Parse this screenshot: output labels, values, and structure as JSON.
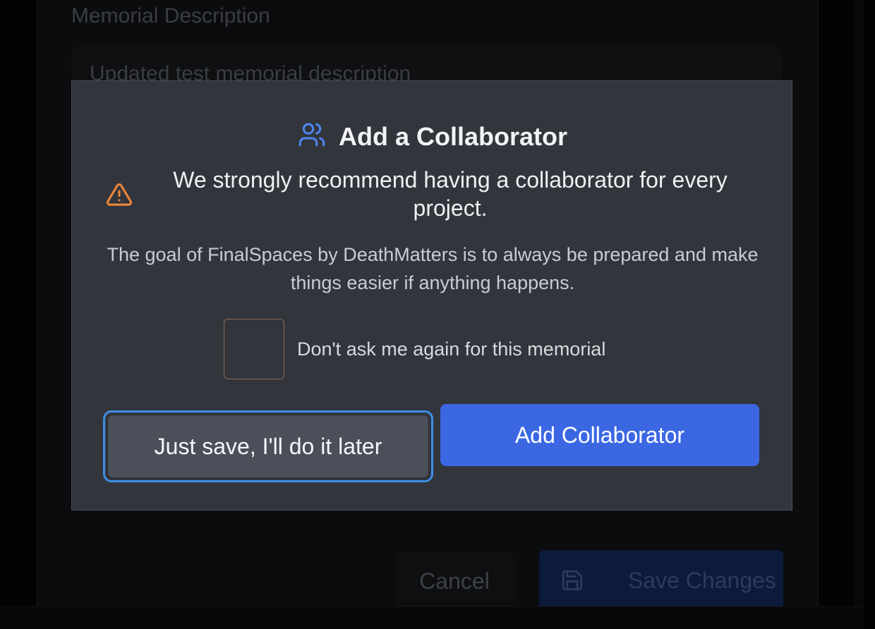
{
  "background": {
    "field_label": "Memorial Description",
    "field_value": "Updated test memorial description",
    "cancel_label": "Cancel",
    "save_label": "Save Changes",
    "save_icon": "save-icon"
  },
  "modal": {
    "title_icon": "users-icon",
    "title": "Add a Collaborator",
    "warning_icon": "warning-icon",
    "headline": "We strongly recommend having a collaborator for every project.",
    "description": "The goal of FinalSpaces by DeathMatters is to always be prepared and make things easier if anything happens.",
    "checkbox": {
      "label": "Don't ask me again for this memorial",
      "checked": false
    },
    "secondary_button_label": "Just save, I'll do it later",
    "primary_button_label": "Add Collaborator"
  },
  "colors": {
    "accent": "#3b67e3",
    "focus_ring": "#3f8ee6",
    "warning": "#e8843a",
    "users_icon": "#4f86f0"
  }
}
